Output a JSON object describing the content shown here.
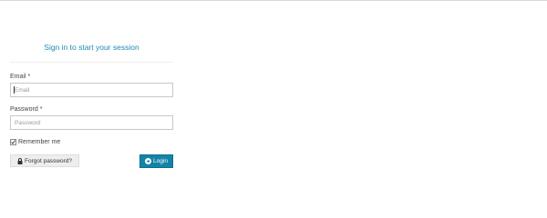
{
  "login": {
    "title": "Sign in to start your session",
    "email": {
      "label": "Email",
      "required_mark": "*",
      "placeholder": "Email",
      "value": ""
    },
    "password": {
      "label": "Password",
      "required_mark": "*",
      "placeholder": "Password",
      "value": ""
    },
    "remember": {
      "label": "Remember me",
      "checked": true
    },
    "forgot_button": {
      "label": "Forgot password?",
      "icon": "lock-icon"
    },
    "login_button": {
      "label": "Login",
      "icon": "arrow-circle-right-icon"
    }
  },
  "colors": {
    "title": "#1f8ab4",
    "login_button_bg": "#1483a8",
    "forgot_button_bg": "#eeeeee"
  }
}
